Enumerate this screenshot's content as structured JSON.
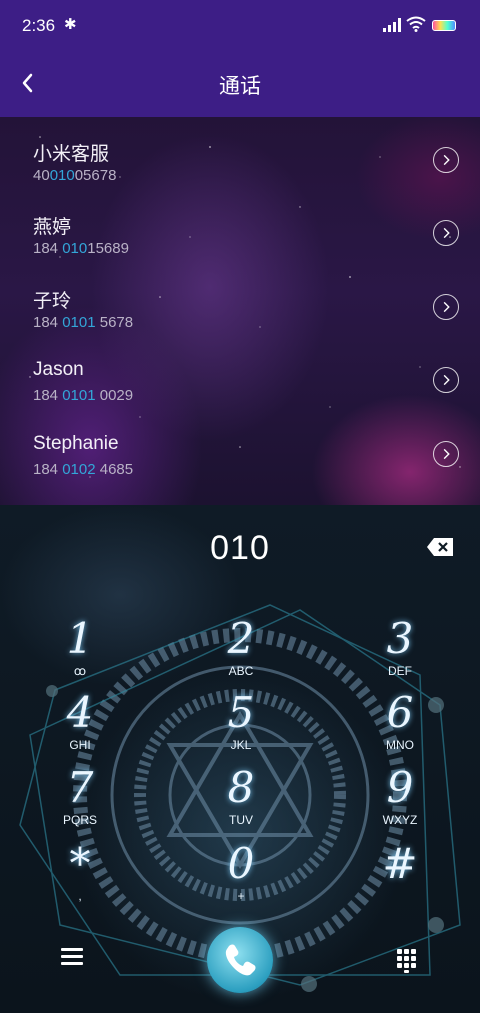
{
  "status_bar": {
    "time": "2:36",
    "bluetooth_icon": "bluetooth-icon",
    "signal_icon": "signal-icon",
    "wifi_icon": "wifi-icon",
    "battery_icon": "battery-icon"
  },
  "app_bar": {
    "title": "通话",
    "back_icon": "chevron-left-icon"
  },
  "results": [
    {
      "name": "小米客服",
      "num_pre": "40",
      "num_hl": "010",
      "num_post": "05678"
    },
    {
      "name": "燕婷",
      "num_pre": "184 ",
      "num_hl": "010",
      "num_post": "15689"
    },
    {
      "name": "子玲",
      "num_pre": "184 ",
      "num_hl": "0101",
      "num_post": " 5678"
    },
    {
      "name": "Jason",
      "num_pre": "184 ",
      "num_hl": "0101",
      "num_post": " 0029"
    },
    {
      "name": "Stephanie",
      "num_pre": "184 ",
      "num_hl": "0102",
      "num_post": " 4685"
    }
  ],
  "dialer": {
    "entered": "010",
    "keys": [
      {
        "digit": "1",
        "letters": "ꝏ"
      },
      {
        "digit": "2",
        "letters": "ABC"
      },
      {
        "digit": "3",
        "letters": "DEF"
      },
      {
        "digit": "4",
        "letters": "GHI"
      },
      {
        "digit": "5",
        "letters": "JKL"
      },
      {
        "digit": "6",
        "letters": "MNO"
      },
      {
        "digit": "7",
        "letters": "PQRS"
      },
      {
        "digit": "8",
        "letters": "TUV"
      },
      {
        "digit": "9",
        "letters": "WXYZ"
      },
      {
        "digit": "*",
        "letters": ","
      },
      {
        "digit": "0",
        "letters": "+"
      },
      {
        "digit": "#",
        "letters": ""
      }
    ]
  },
  "accent": {
    "appbar": "#3d1e86",
    "highlight": "#33a6d8",
    "call": "#2c9fc0"
  }
}
